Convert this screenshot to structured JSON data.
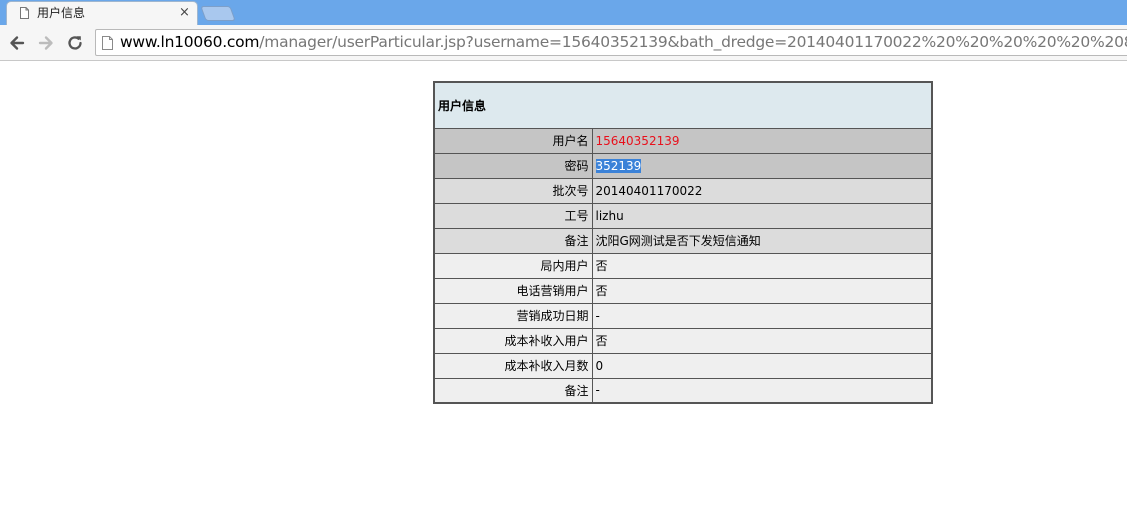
{
  "browser": {
    "tab_title": "用户信息",
    "tab_close": "×",
    "url_host": "www.ln10060.com",
    "url_rest": "/manager/userParticular.jsp?username=15640352139&bath_dredge=20140401170022%20%20%20%20%20%208"
  },
  "table": {
    "title": "用户信息",
    "rows": [
      {
        "label": "用户名",
        "value": "15640352139"
      },
      {
        "label": "密码",
        "value": "352139"
      },
      {
        "label": "批次号",
        "value": "20140401170022"
      },
      {
        "label": "工号",
        "value": "lizhu"
      },
      {
        "label": "备注",
        "value": "沈阳G网测试是否下发短信通知"
      },
      {
        "label": "局内用户",
        "value": "否"
      },
      {
        "label": "电话营销用户",
        "value": "否"
      },
      {
        "label": "营销成功日期",
        "value": "-"
      },
      {
        "label": "成本补收入用户",
        "value": "否"
      },
      {
        "label": "成本补收入月数",
        "value": "0"
      },
      {
        "label": "备注",
        "value": "-"
      }
    ]
  },
  "colors": {
    "username_value": "#e8101c",
    "selection": "#3b82d8",
    "header_bg": "#dde9ee",
    "tabstrip_bg": "#6aa7ea"
  }
}
